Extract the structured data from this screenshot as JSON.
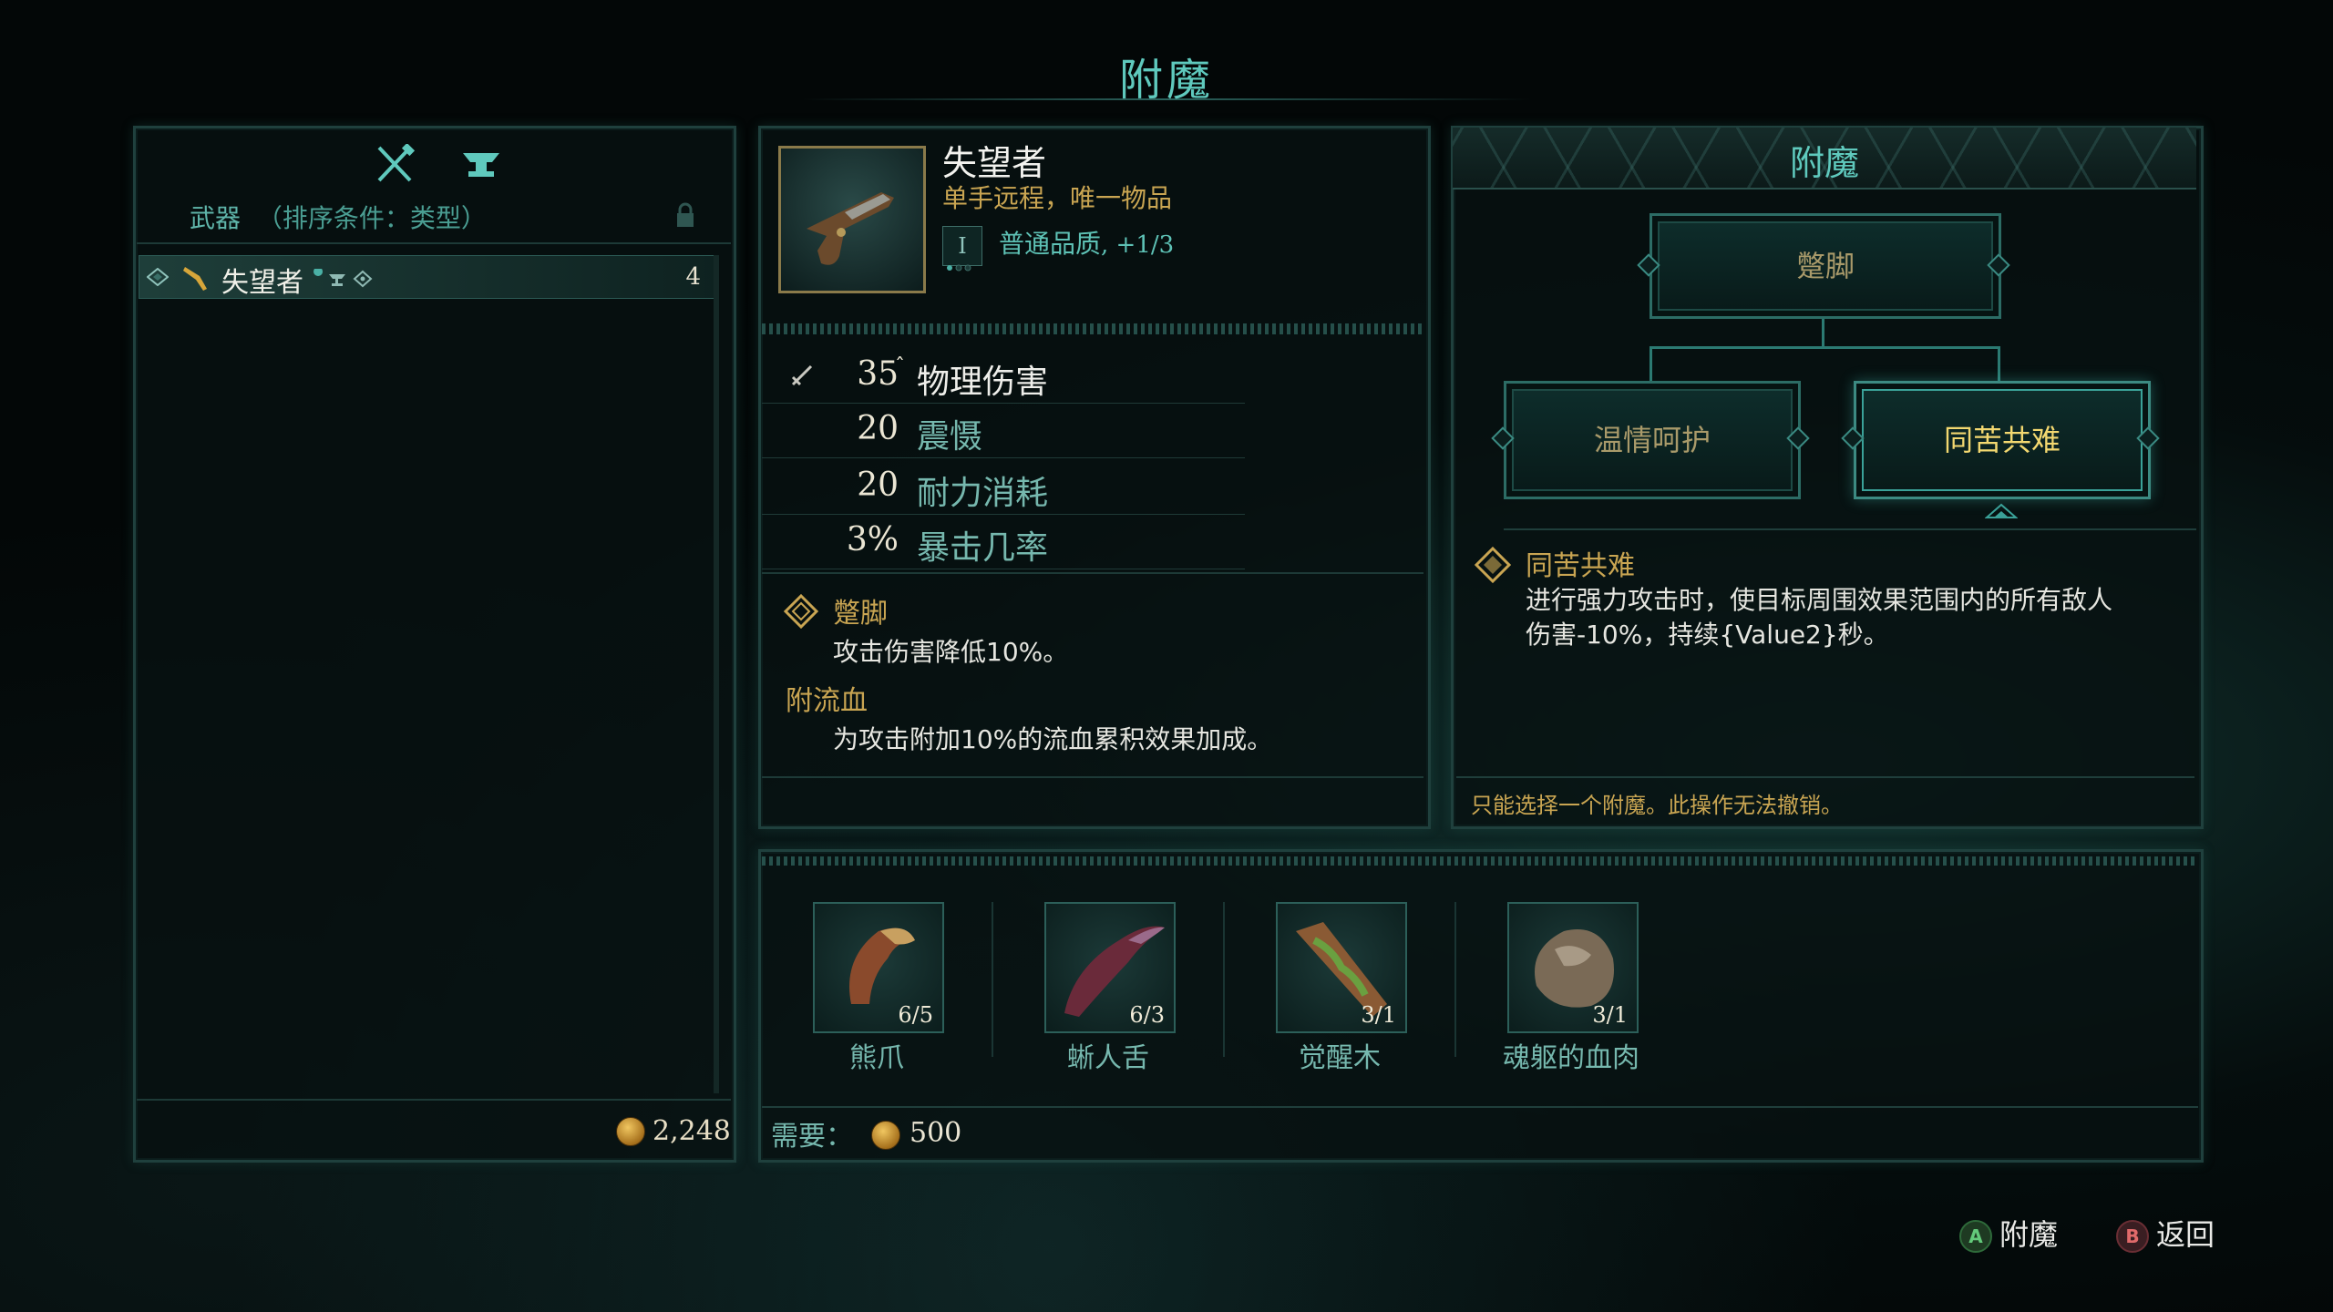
{
  "screen_title": "附魔",
  "left_panel": {
    "category_label": "武器",
    "sort_label": "（排序条件：类型）",
    "items": [
      {
        "name": "失望者",
        "count": "4"
      }
    ],
    "currency": "2,248"
  },
  "item": {
    "name": "失望者",
    "type": "单手远程，唯一物品",
    "tier": "I",
    "quality": "普通品质",
    "quality_level": ", +1/3",
    "stats": [
      {
        "value": "35",
        "name": "物理伤害"
      },
      {
        "value": "20",
        "name": "震慑"
      },
      {
        "value": "20",
        "name": "耐力消耗"
      },
      {
        "value": "3%",
        "name": "暴击几率"
      }
    ],
    "enchant_name": "蹩脚",
    "enchant_desc": "攻击伤害降低10%。",
    "bleed_name": "附流血",
    "bleed_desc": "为攻击附加10%的流血累积效果加成。"
  },
  "enchant_panel": {
    "title": "附魔",
    "nodes": {
      "top": "蹩脚",
      "left": "温情呵护",
      "right": "同苦共难"
    },
    "selected_name": "同苦共难",
    "selected_desc_line1": "进行强力攻击时，使目标周围效果范围内的所有敌人",
    "selected_desc_line2": "伤害-10%，持续{Value2}秒。",
    "warning": "只能选择一个附魔。此操作无法撤销。"
  },
  "materials": [
    {
      "name": "熊爪",
      "count": "6/5",
      "icon": "bear-claw-icon"
    },
    {
      "name": "蜥人舌",
      "count": "6/3",
      "icon": "lizard-tongue-icon"
    },
    {
      "name": "觉醒木",
      "count": "3/1",
      "icon": "awakened-wood-icon"
    },
    {
      "name": "魂躯的血肉",
      "count": "3/1",
      "icon": "soul-flesh-icon"
    }
  ],
  "requirement": {
    "label": "需要：",
    "cost": "500"
  },
  "footer": {
    "confirm_key": "A",
    "confirm_label": "附魔",
    "back_key": "B",
    "back_label": "返回"
  },
  "colors": {
    "accent": "#5fc9bd",
    "gold": "#c9a552",
    "panel_border": "#1f403d"
  }
}
